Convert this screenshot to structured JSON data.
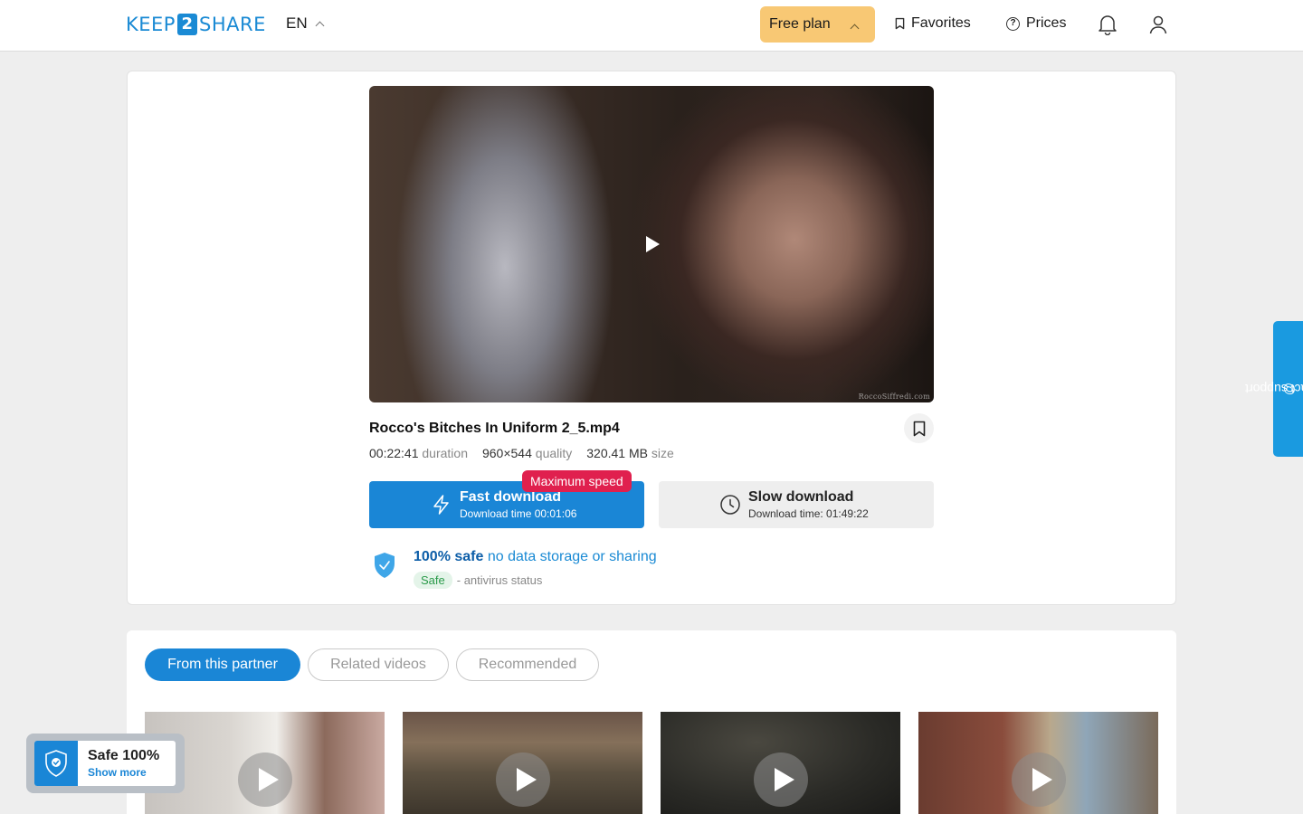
{
  "header": {
    "logo_left": "KEEP",
    "logo_mid": "2",
    "logo_right": "SHARE",
    "language": "EN",
    "plan_label": "Free plan",
    "favorites_label": "Favorites",
    "prices_label": "Prices",
    "icons": [
      "chevron-up-icon",
      "bookmark-icon",
      "question-icon",
      "bell-icon",
      "user-icon"
    ]
  },
  "file": {
    "title": "Rocco's Bitches In Uniform 2_5.mp4",
    "watermark": "RoccoSiffredi.com",
    "duration_value": "00:22:41",
    "duration_label": "duration",
    "quality_value": "960×544",
    "quality_label": "quality",
    "size_value": "320.41 MB",
    "size_label": "size"
  },
  "download": {
    "fast_label": "Fast download",
    "fast_time": "Download time 00:01:06",
    "max_speed_badge": "Maximum speed",
    "slow_label": "Slow download",
    "slow_time": "Download time: 01:49:22"
  },
  "safety": {
    "headline_bold": "100% safe",
    "headline_rest": " no data storage or sharing",
    "av_badge": "Safe",
    "av_text": "- antivirus status"
  },
  "tabs": [
    {
      "label": "From this partner",
      "active": true
    },
    {
      "label": "Related videos",
      "active": false
    },
    {
      "label": "Recommended",
      "active": false
    }
  ],
  "safe_widget": {
    "title": "Safe 100%",
    "link": "Show more"
  },
  "support_label": "contact support",
  "colors": {
    "accent": "#1a86d6",
    "plan": "#f8c874",
    "badge_red": "#e0204e",
    "safe_green": "#2a9a4a"
  }
}
